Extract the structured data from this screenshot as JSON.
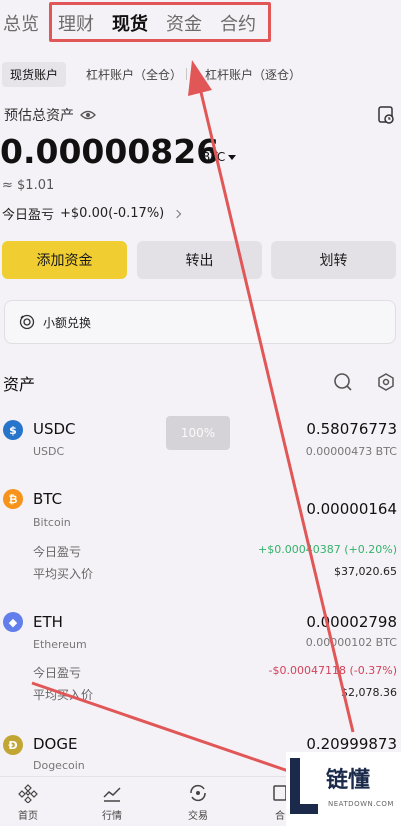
{
  "tabs": [
    "总览",
    "理财",
    "现货",
    "资金",
    "合约"
  ],
  "active_tab": "现货",
  "subtabs": [
    "现货账户",
    "杠杆账户（全仓）",
    "杠杆账户（逐仓）"
  ],
  "estimate_label": "预估总资产",
  "balance": "0.00000826",
  "balance_unit": "BTC",
  "approx": "≈ $1.01",
  "pnl_label": "今日盈亏",
  "pnl_value": "+$0.00(-0.17%)",
  "buttons": {
    "add": "添加资金",
    "out": "转出",
    "transfer": "划转"
  },
  "small_convert": "小额兑换",
  "assets_title": "资产",
  "assets": [
    {
      "symbol": "USDC",
      "name": "USDC",
      "amount": "0.58076773",
      "btc": "0.00000473 BTC",
      "badge": "100%",
      "icon_color": "#2775ca"
    },
    {
      "symbol": "BTC",
      "name": "Bitcoin",
      "amount": "0.00000164",
      "pnl_label": "今日盈亏",
      "pnl": "+$0.00040387 (+0.20%)",
      "avg_label": "平均买入价",
      "avg": "$37,020.65",
      "icon_color": "#f7931a"
    },
    {
      "symbol": "ETH",
      "name": "Ethereum",
      "amount": "0.00002798",
      "btc": "0.00000102 BTC",
      "pnl_label": "今日盈亏",
      "pnl": "-$0.00047118 (-0.37%)",
      "avg_label": "平均买入价",
      "avg": "$2,078.36",
      "icon_color": "#627eea"
    },
    {
      "symbol": "DOGE",
      "name": "Dogecoin",
      "amount": "0.20999873",
      "icon_color": "#c2a633"
    }
  ],
  "nav": [
    "首页",
    "行情",
    "交易",
    "合"
  ],
  "watermark": {
    "title": "链懂",
    "sub": "NEATDOWN.COM"
  },
  "colors": {
    "accent": "#f0cd30",
    "up": "#35b26b",
    "down": "#d1435b",
    "annotation": "#e15757"
  }
}
